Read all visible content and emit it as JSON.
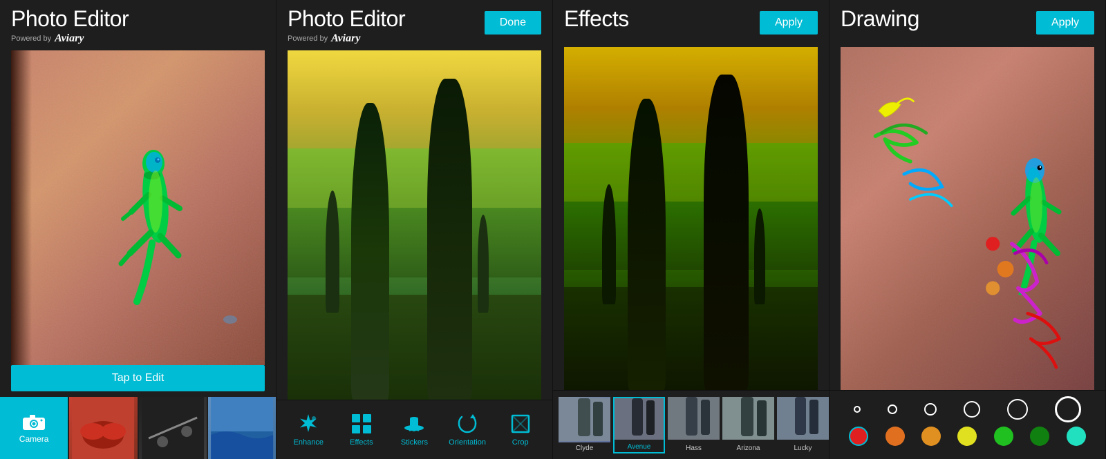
{
  "panels": [
    {
      "id": "panel1",
      "title": "Photo Editor",
      "powered_by": "Powered by",
      "aviary": "Aviary",
      "tap_to_edit": "Tap to Edit",
      "camera_label": "Camera"
    },
    {
      "id": "panel2",
      "title": "Photo Editor",
      "powered_by": "Powered by",
      "aviary": "Aviary",
      "done_label": "Done"
    },
    {
      "id": "panel3",
      "title": "Effects",
      "apply_label": "Apply"
    },
    {
      "id": "panel4",
      "title": "Drawing",
      "apply_label": "Apply"
    }
  ],
  "toolbar": {
    "tools": [
      {
        "id": "enhance",
        "label": "Enhance",
        "icon": "★"
      },
      {
        "id": "effects",
        "label": "Effects",
        "icon": "▦"
      },
      {
        "id": "stickers",
        "label": "Stickers",
        "icon": "🎩"
      },
      {
        "id": "orientation",
        "label": "Orientation",
        "icon": "↺"
      },
      {
        "id": "crop",
        "label": "Crop",
        "icon": "⊡"
      }
    ]
  },
  "effects": {
    "filters": [
      {
        "id": "clyde",
        "label": "Clyde"
      },
      {
        "id": "avenue",
        "label": "Avenue",
        "selected": true
      },
      {
        "id": "hass",
        "label": "Hass"
      },
      {
        "id": "arizona",
        "label": "Arizona"
      },
      {
        "id": "lucky",
        "label": "Lucky"
      }
    ]
  },
  "drawing": {
    "sizes": [
      6,
      10,
      14,
      20,
      28,
      38
    ],
    "colors": [
      "#e02020",
      "#e06020",
      "#e09020",
      "#e0e020",
      "#20c020",
      "#107010",
      "#20e0c0"
    ]
  }
}
